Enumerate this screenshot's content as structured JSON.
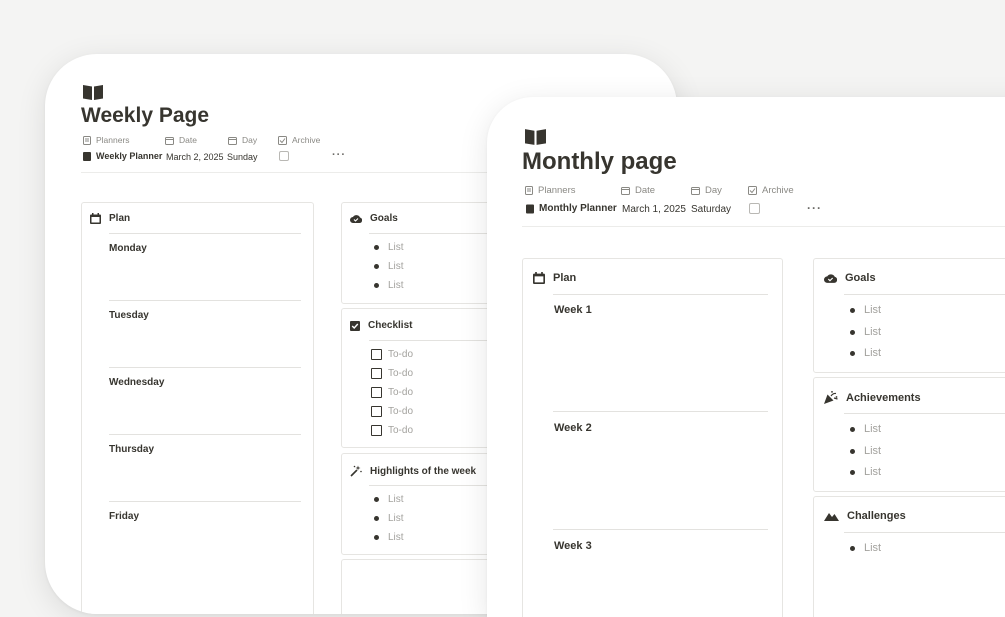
{
  "weekly": {
    "title": "Weekly Page",
    "icon": "open-book-icon",
    "props": {
      "planners_label": "Planners",
      "date_label": "Date",
      "day_label": "Day",
      "archive_label": "Archive",
      "planners_value": "Weekly Planner",
      "date_value": "March 2, 2025",
      "day_value": "Sunday",
      "archive_checked": false,
      "more": "···"
    },
    "plan": {
      "title": "Plan",
      "days": [
        "Monday",
        "Tuesday",
        "Wednesday",
        "Thursday",
        "Friday"
      ]
    },
    "goals": {
      "title": "Goals",
      "items": [
        "List",
        "List",
        "List"
      ]
    },
    "checklist": {
      "title": "Checklist",
      "items": [
        "To-do",
        "To-do",
        "To-do",
        "To-do",
        "To-do"
      ]
    },
    "highlights": {
      "title": "Highlights of the week",
      "items": [
        "List",
        "List",
        "List"
      ]
    }
  },
  "monthly": {
    "title": "Monthly page",
    "icon": "open-book-icon",
    "props": {
      "planners_label": "Planners",
      "date_label": "Date",
      "day_label": "Day",
      "archive_label": "Archive",
      "planners_value": "Monthly Planner",
      "date_value": "March 1, 2025",
      "day_value": "Saturday",
      "archive_checked": false,
      "more": "···"
    },
    "plan": {
      "title": "Plan",
      "weeks": [
        "Week 1",
        "Week 2",
        "Week 3"
      ]
    },
    "goals": {
      "title": "Goals",
      "items": [
        "List",
        "List",
        "List"
      ]
    },
    "achievements": {
      "title": "Achievements",
      "items": [
        "List",
        "List",
        "List"
      ]
    },
    "challenges": {
      "title": "Challenges",
      "items": [
        "List"
      ]
    }
  },
  "colors": {
    "text": "#37352f",
    "muted": "#8a8984",
    "placeholder": "#a3a29e",
    "background": "#f4f4f3",
    "card": "#ffffff"
  }
}
